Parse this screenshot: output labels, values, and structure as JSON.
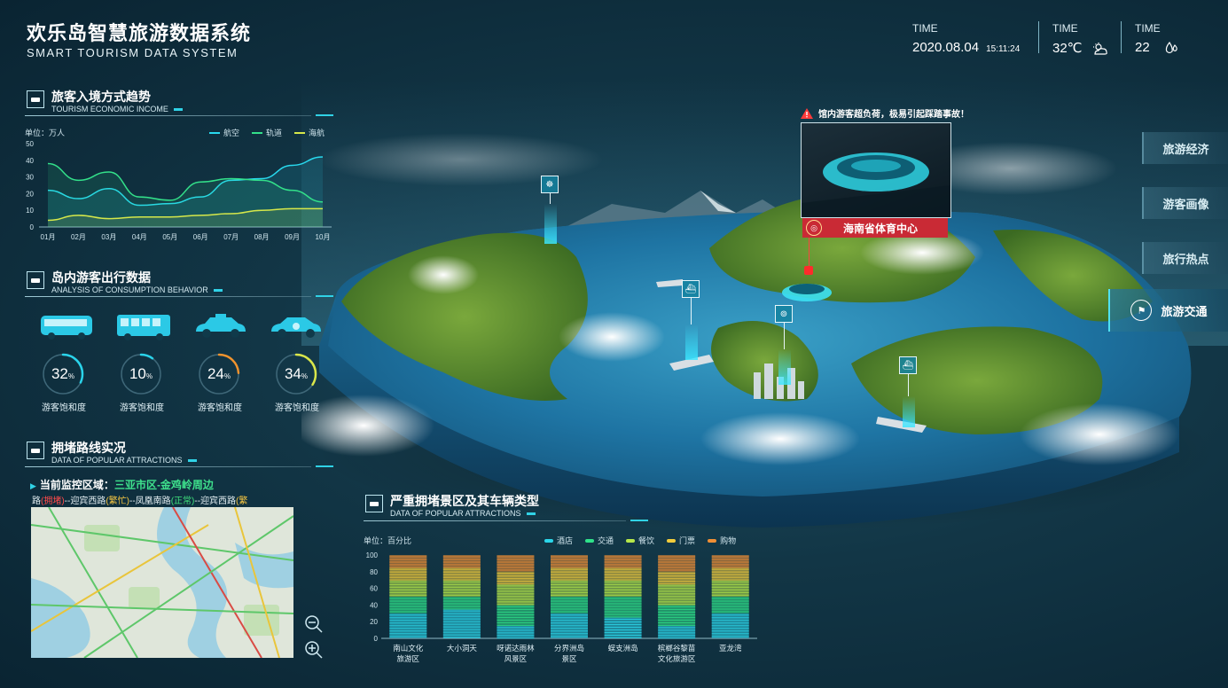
{
  "header": {
    "title_cn": "欢乐岛智慧旅游数据系统",
    "title_en": "SMART TOURISM DATA SYSTEM",
    "blocks": [
      {
        "label": "TIME",
        "value": "2020.08.04",
        "sub": "15:11:24"
      },
      {
        "label": "TIME",
        "value": "32℃",
        "icon": "weather-sun-cloud-icon"
      },
      {
        "label": "TIME",
        "value": "22",
        "icon": "water-drop-icon"
      }
    ]
  },
  "panel1": {
    "title_cn": "旅客入境方式趋势",
    "title_en": "TOURISM ECONOMIC INCOME",
    "unit": "单位：万人",
    "legend": [
      "航空",
      "轨道",
      "海航"
    ],
    "chart_data": {
      "type": "line",
      "x": [
        "01月",
        "02月",
        "03月",
        "04月",
        "05月",
        "06月",
        "07月",
        "08月",
        "09月",
        "10月"
      ],
      "ylim": [
        0,
        50
      ],
      "yticks": [
        "50",
        "40",
        "30",
        "20",
        "10",
        "0"
      ],
      "series": [
        {
          "name": "航空",
          "color": "#28d9ee",
          "values": [
            22,
            17,
            23,
            13,
            14,
            18,
            28,
            29,
            37,
            42
          ]
        },
        {
          "name": "轨道",
          "color": "#33e08a",
          "values": [
            38,
            28,
            33,
            18,
            16,
            27,
            29,
            28,
            22,
            15
          ]
        },
        {
          "name": "海航",
          "color": "#d6e84a",
          "values": [
            4,
            7,
            5,
            6,
            6,
            7,
            8,
            10,
            11,
            11
          ]
        }
      ]
    }
  },
  "panel2": {
    "title_cn": "岛内游客出行数据",
    "title_en": "ANALYSIS OF CONSUMPTION BEHAVIOR",
    "items": [
      {
        "value": "32",
        "unit": "%",
        "label": "游客饱和度",
        "icon": "coach-bus-icon",
        "color": "#2ad3ea",
        "pct": 32
      },
      {
        "value": "10",
        "unit": "%",
        "label": "游客饱和度",
        "icon": "city-bus-icon",
        "color": "#2ad3ea",
        "pct": 10
      },
      {
        "value": "24",
        "unit": "%",
        "label": "游客饱和度",
        "icon": "taxi-icon",
        "color": "#f0932e",
        "pct": 24
      },
      {
        "value": "34",
        "unit": "%",
        "label": "游客饱和度",
        "icon": "car-icon",
        "color": "#d9e64a",
        "pct": 34
      }
    ]
  },
  "panel3": {
    "title_cn": "拥堵路线实况",
    "title_en": "DATA OF POPULAR ATTRACTIONS",
    "region_label": "当前监控区域：",
    "region_value": "三亚市区-金鸡岭周边",
    "roads": [
      {
        "text": "路",
        "status": "(拥堵)",
        "status_color": "#ff4a4a"
      },
      {
        "text": "--迎宾西路",
        "status": "(繁忙)",
        "status_color": "#f5c542"
      },
      {
        "text": "--凤凰南路",
        "status": "(正常)",
        "status_color": "#3fe07c"
      },
      {
        "text": "--迎宾西路",
        "status": "(繁",
        "status_color": "#f5c542"
      }
    ]
  },
  "panel4": {
    "title_cn": "严重拥堵景区及其车辆类型",
    "title_en": "DATA OF POPULAR ATTRACTIONS",
    "unit": "单位：百分比",
    "legend": [
      {
        "name": "酒店",
        "color": "#2bd6ea"
      },
      {
        "name": "交通",
        "color": "#2fe28a"
      },
      {
        "name": "餐饮",
        "color": "#b7e84a"
      },
      {
        "name": "门票",
        "color": "#f2cc3c"
      },
      {
        "name": "购物",
        "color": "#f08f35"
      }
    ],
    "chart_data": {
      "type": "bar",
      "stacked": true,
      "ylim": [
        0,
        100
      ],
      "yticks": [
        "100",
        "80",
        "60",
        "40",
        "20",
        "0"
      ],
      "categories": [
        "南山文化旅游区",
        "大小洞天",
        "呀诺达雨林风景区",
        "分界洲岛景区",
        "蜈支洲岛",
        "槟榔谷黎苗文化旅游区",
        "亚龙湾"
      ],
      "category_lines": [
        [
          "南山文化",
          "旅游区"
        ],
        [
          "大小洞天"
        ],
        [
          "呀诺达雨林",
          "风景区"
        ],
        [
          "分界洲岛",
          "景区"
        ],
        [
          "蜈支洲岛"
        ],
        [
          "槟榔谷黎苗",
          "文化旅游区"
        ],
        [
          "亚龙湾"
        ]
      ],
      "series": [
        {
          "name": "酒店",
          "values": [
            30,
            35,
            15,
            30,
            25,
            15,
            30
          ]
        },
        {
          "name": "交通",
          "values": [
            20,
            15,
            25,
            20,
            25,
            25,
            20
          ]
        },
        {
          "name": "餐饮",
          "values": [
            20,
            20,
            25,
            20,
            20,
            25,
            20
          ]
        },
        {
          "name": "门票",
          "values": [
            15,
            15,
            15,
            15,
            15,
            15,
            15
          ]
        },
        {
          "name": "购物",
          "values": [
            15,
            15,
            20,
            15,
            15,
            20,
            15
          ]
        }
      ]
    }
  },
  "map": {
    "alert_text": "馆内游客超负荷，极易引起踩踏事故！",
    "venue_name": "海南省体育中心",
    "pins": [
      "ferris-wheel-icon",
      "ship-icon",
      "tower-icon",
      "ship-icon"
    ]
  },
  "right_nav": [
    "旅游经济",
    "游客画像",
    "旅行热点",
    "旅游交通"
  ],
  "right_nav_active": "旅游交通"
}
